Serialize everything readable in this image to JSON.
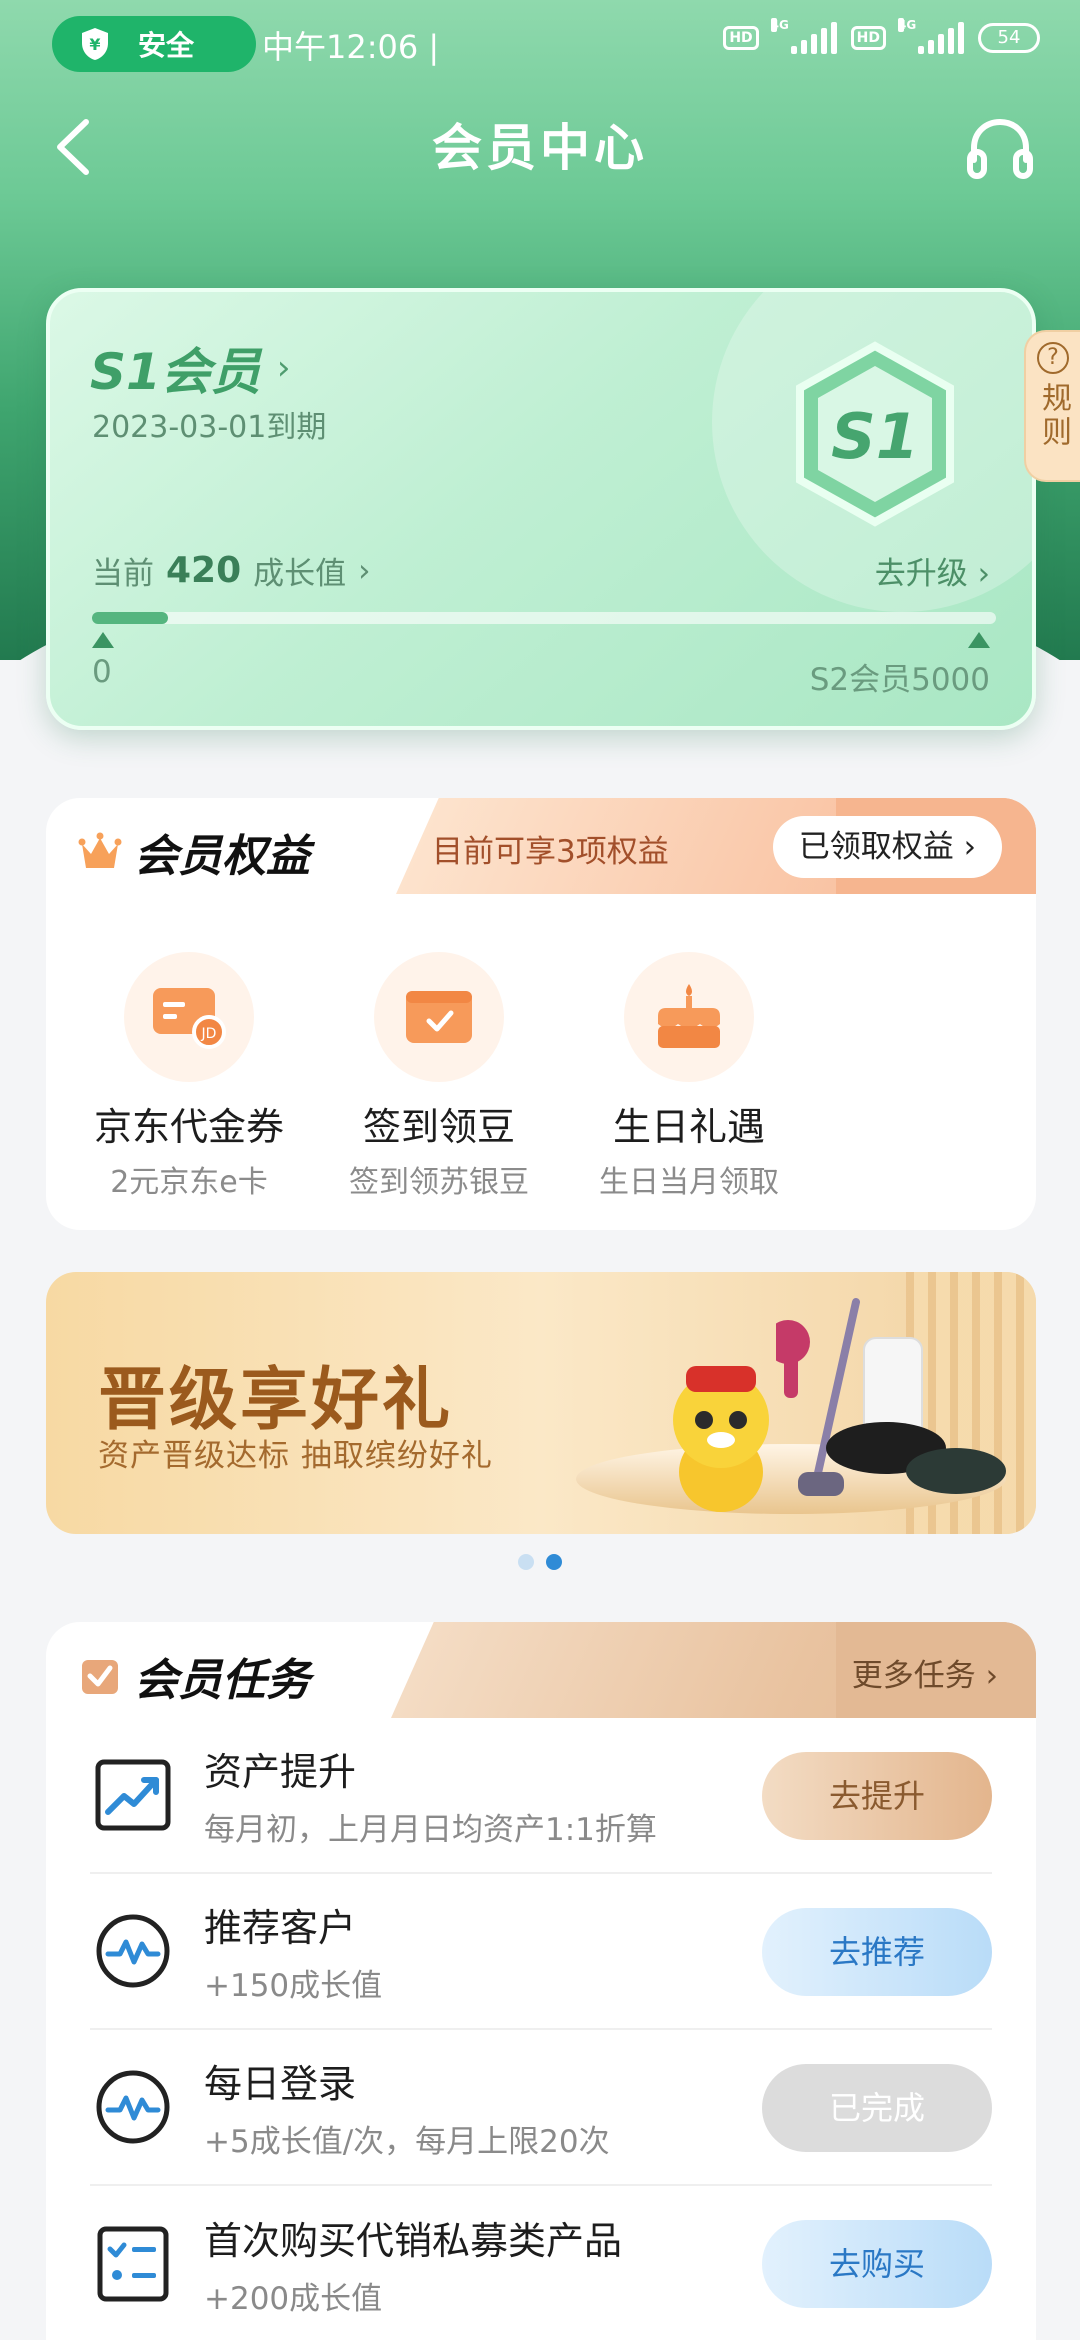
{
  "status_bar": {
    "safe_label": "安全",
    "time": "中午12:06 |",
    "network_1": "4G",
    "network_2": "4G",
    "hd_1": "HD",
    "hd_2": "HD",
    "battery": "54"
  },
  "nav": {
    "title": "会员中心"
  },
  "member_card": {
    "level_name": "S1会员",
    "expiry": "2023-03-01到期",
    "badge_text": "S1",
    "growth_prefix": "当前",
    "growth_value": "420",
    "growth_suffix": "成长值",
    "upgrade_label": "去升级",
    "progress_min": "0",
    "progress_max": "S2会员5000",
    "progress_fraction": 0.084
  },
  "rules_tab": {
    "label": "规则"
  },
  "benefits": {
    "title": "会员权益",
    "tip": "目前可享3项权益",
    "claimed_label": "已领取权益",
    "items": [
      {
        "name": "京东代金券",
        "desc": "2元京东e卡",
        "icon": "voucher-card-icon"
      },
      {
        "name": "签到领豆",
        "desc": "签到领苏银豆",
        "icon": "check-in-wallet-icon"
      },
      {
        "name": "生日礼遇",
        "desc": "生日当月领取",
        "icon": "birthday-cake-icon"
      }
    ]
  },
  "banner": {
    "title": "晋级享好礼",
    "subtitle": "资产晋级达标 抽取缤纷好礼",
    "page_count": 2,
    "active_page": 2
  },
  "tasks": {
    "title": "会员任务",
    "more_label": "更多任务",
    "items": [
      {
        "name": "资产提升",
        "desc": "每月初，上月月日均资产1:1折算",
        "button": "去提升",
        "style": "gold",
        "icon": "trend-up-icon"
      },
      {
        "name": "推荐客户",
        "desc": "+150成长值",
        "button": "去推荐",
        "style": "blue",
        "icon": "pulse-icon"
      },
      {
        "name": "每日登录",
        "desc": "+5成长值/次，每月上限20次",
        "button": "已完成",
        "style": "gray",
        "icon": "pulse-icon"
      },
      {
        "name": "首次购买代销私募类产品",
        "desc": "+200成长值",
        "button": "去购买",
        "style": "blue",
        "icon": "checklist-icon"
      }
    ]
  },
  "colors": {
    "brand_green": "#1fb46a",
    "card_green": "#a9e7c4",
    "accent_blue": "#2f8bd6",
    "accent_gold": "#e3b58d"
  }
}
